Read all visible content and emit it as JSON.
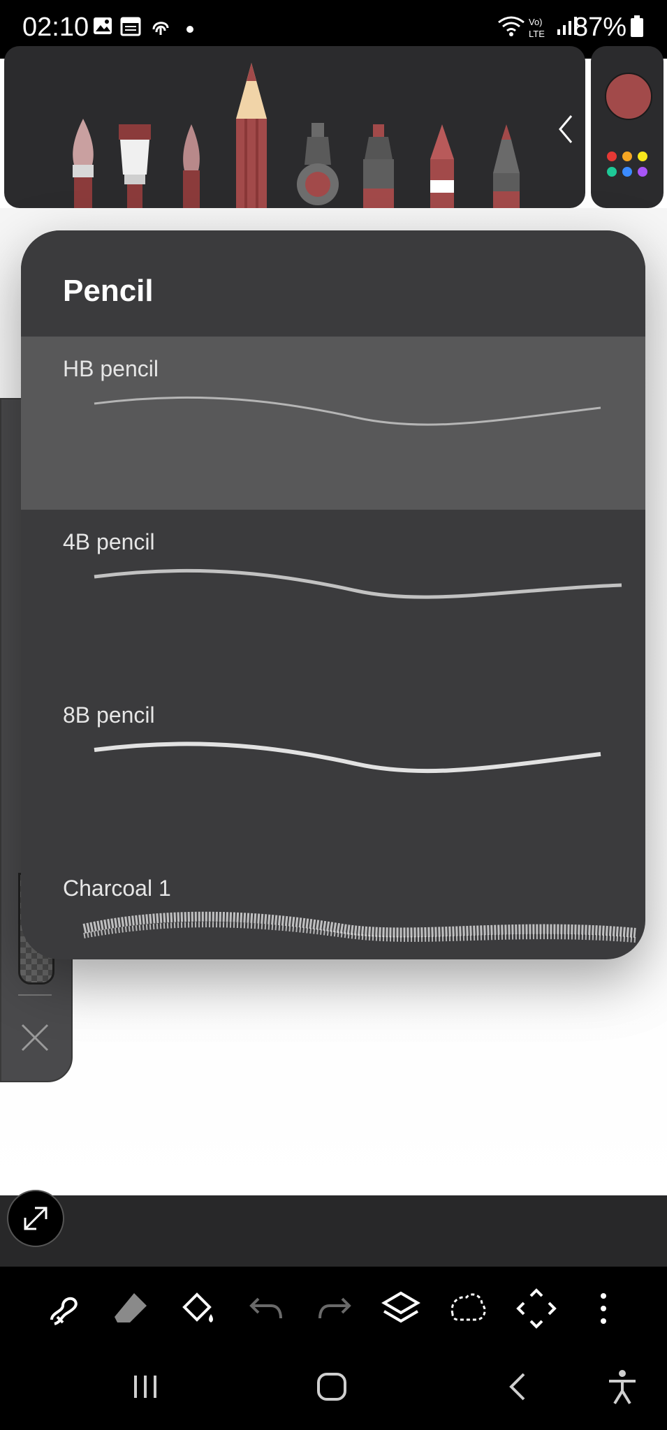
{
  "status_bar": {
    "time": "02:10",
    "battery": "87%",
    "icons": [
      "image-icon",
      "calendar-icon",
      "fingerprint-icon",
      "dot-icon",
      "wifi-icon",
      "volte-icon",
      "signal-icon",
      "battery-icon"
    ]
  },
  "brush_toolbar": {
    "brushes": [
      "round-brush-icon",
      "flat-brush-icon",
      "watercolor-brush-icon",
      "pencil-icon",
      "airbrush-icon",
      "marker-icon",
      "crayon-icon",
      "pen-icon"
    ],
    "collapse_icon": "chevron-left-icon"
  },
  "color_panel": {
    "current_color": "#a24a4a",
    "palette_dots": [
      "#e53935",
      "#f5a623",
      "#f8e71c",
      "#1ec997",
      "#3b8bff",
      "#a855f7"
    ]
  },
  "popup": {
    "title": "Pencil",
    "items": [
      {
        "label": "HB pencil",
        "selected": true
      },
      {
        "label": "4B pencil",
        "selected": false
      },
      {
        "label": "8B pencil",
        "selected": false
      },
      {
        "label": "Charcoal 1",
        "selected": false
      }
    ]
  },
  "toolbar": {
    "tools": [
      "brush-select-icon",
      "eraser-icon",
      "fill-bucket-icon",
      "undo-icon",
      "redo-icon",
      "layers-icon",
      "lasso-icon",
      "transform-icon",
      "more-icon"
    ]
  },
  "colors": {
    "panel": "#2b2b2d",
    "popup": "#3b3b3d",
    "selected_row": "#585859",
    "accent": "#a24a4a"
  }
}
